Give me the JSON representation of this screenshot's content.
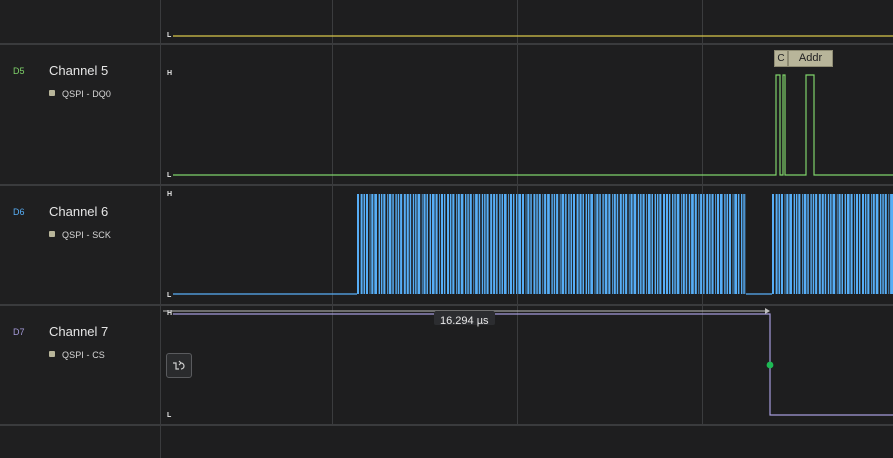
{
  "channels": [
    {
      "tag": "D5",
      "name": "Channel 5",
      "analyzer": "QSPI - DQ0",
      "color": "#7fd36a",
      "high_label": "H",
      "low_label": "L"
    },
    {
      "tag": "D6",
      "name": "Channel 6",
      "analyzer": "QSPI - SCK",
      "color": "#57aef6",
      "high_label": "H",
      "low_label": "L"
    },
    {
      "tag": "D7",
      "name": "Channel 7",
      "analyzer": "QSPI - CS",
      "color": "#a59bdb",
      "high_label": "H",
      "low_label": "L"
    }
  ],
  "top_channel": {
    "low_label": "L",
    "color": "#d7c64a"
  },
  "decoded_frames": [
    {
      "label": "C"
    },
    {
      "label": "Addr"
    }
  ],
  "measurement": {
    "label": "16.294 µs"
  },
  "trigger_icon": "edge-trigger-icon",
  "colors": {
    "marker_dot": "#1db954",
    "frame_bg": "#b8b59a"
  }
}
